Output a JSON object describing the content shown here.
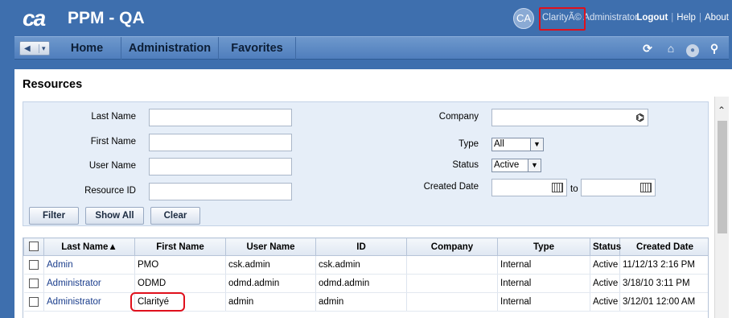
{
  "header": {
    "logo_text": "ca",
    "app_title": "PPM - QA",
    "avatar_initials": "CA",
    "user_name": "ClarityÃ© Administrator",
    "links": [
      "Logout",
      "Help",
      "About"
    ]
  },
  "nav": {
    "items": [
      "Home",
      "Administration",
      "Favorites"
    ]
  },
  "page": {
    "title": "Resources"
  },
  "filter": {
    "last_name_label": "Last Name",
    "first_name_label": "First Name",
    "user_name_label": "User Name",
    "resource_id_label": "Resource ID",
    "company_label": "Company",
    "type_label": "Type",
    "type_value": "All",
    "status_label": "Status",
    "status_value": "Active",
    "created_date_label": "Created Date",
    "to_label": "to",
    "buttons": {
      "filter": "Filter",
      "show_all": "Show All",
      "clear": "Clear"
    }
  },
  "table": {
    "columns": [
      "Last Name▲",
      "First Name",
      "User Name",
      "ID",
      "Company",
      "Type",
      "Status",
      "Created Date"
    ],
    "rows": [
      {
        "last_name": "Admin",
        "first_name": "PMO",
        "user_name": "csk.admin",
        "id": "csk.admin",
        "company": "",
        "type": "Internal",
        "status": "Active",
        "created": "11/12/13 2:16 PM"
      },
      {
        "last_name": "Administrator",
        "first_name": "ODMD",
        "user_name": "odmd.admin",
        "id": "odmd.admin",
        "company": "",
        "type": "Internal",
        "status": "Active",
        "created": "3/18/10 3:11 PM"
      },
      {
        "last_name": "Administrator",
        "first_name": "Clarityé",
        "user_name": "admin",
        "id": "admin",
        "company": "",
        "type": "Internal",
        "status": "Active",
        "created": "3/12/01 12:00 AM"
      }
    ]
  },
  "colors": {
    "header_bg": "#3e6fae",
    "annotation": "#e0101c"
  }
}
